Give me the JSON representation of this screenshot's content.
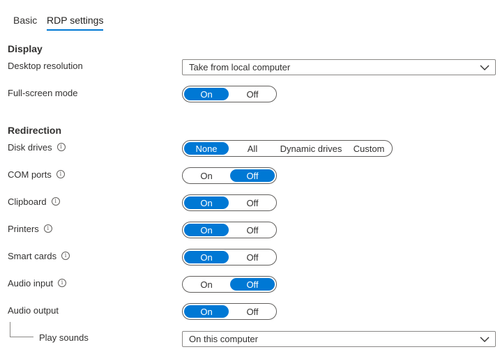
{
  "tabs": {
    "basic": "Basic",
    "rdp": "RDP settings"
  },
  "display": {
    "title": "Display",
    "desktop_resolution_label": "Desktop resolution",
    "desktop_resolution_value": "Take from local computer",
    "fullscreen_label": "Full-screen mode",
    "fullscreen_on": "On",
    "fullscreen_off": "Off",
    "fullscreen_selected": "On"
  },
  "redirection": {
    "title": "Redirection",
    "disk_drives": {
      "label": "Disk drives",
      "options": [
        "None",
        "All",
        "Dynamic drives",
        "Custom"
      ],
      "selected": "None"
    },
    "com_ports": {
      "label": "COM ports",
      "on": "On",
      "off": "Off",
      "selected": "Off"
    },
    "clipboard": {
      "label": "Clipboard",
      "on": "On",
      "off": "Off",
      "selected": "On"
    },
    "printers": {
      "label": "Printers",
      "on": "On",
      "off": "Off",
      "selected": "On"
    },
    "smart_cards": {
      "label": "Smart cards",
      "on": "On",
      "off": "Off",
      "selected": "On"
    },
    "audio_input": {
      "label": "Audio input",
      "on": "On",
      "off": "Off",
      "selected": "Off"
    },
    "audio_output": {
      "label": "Audio output",
      "on": "On",
      "off": "Off",
      "selected": "On"
    },
    "play_sounds": {
      "label": "Play sounds",
      "value": "On this computer"
    }
  },
  "icons": {
    "info": "info-icon",
    "dropdown": "chevron-down-icon"
  },
  "colors": {
    "accent": "#0078d4",
    "text": "#323130",
    "border": "#605e5c"
  }
}
